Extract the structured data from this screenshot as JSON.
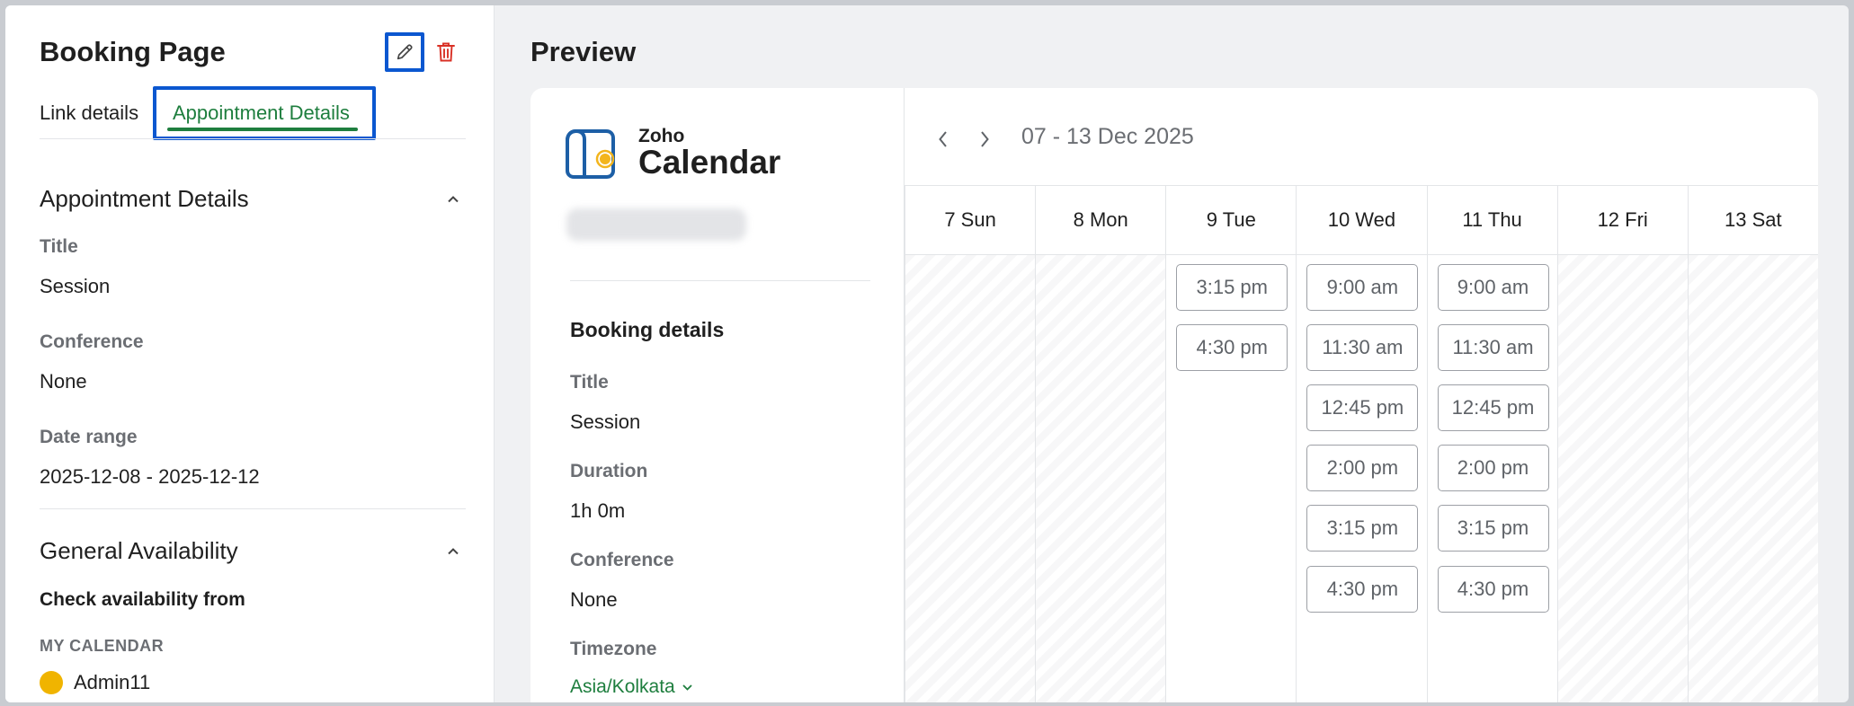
{
  "left_panel": {
    "title": "Booking Page",
    "edit_icon": "pencil-icon",
    "delete_icon": "trash-icon",
    "tabs": [
      {
        "label": "Link details",
        "active": false
      },
      {
        "label": "Appointment Details",
        "active": true
      }
    ],
    "appointment_section": {
      "heading": "Appointment Details",
      "fields": [
        {
          "label": "Title",
          "value": "Session"
        },
        {
          "label": "Conference",
          "value": "None"
        },
        {
          "label": "Date range",
          "value": "2025-12-08 - 2025-12-12"
        }
      ]
    },
    "availability_section": {
      "heading": "General Availability",
      "check_label": "Check availability from",
      "group_label": "MY CALENDAR",
      "calendars": [
        {
          "name": "Admin11",
          "color": "#f0b400"
        }
      ]
    }
  },
  "preview": {
    "title": "Preview",
    "logo": {
      "small": "Zoho",
      "large": "Calendar"
    },
    "booking": {
      "heading": "Booking details",
      "fields": [
        {
          "label": "Title",
          "value": "Session"
        },
        {
          "label": "Duration",
          "value": "1h 0m"
        },
        {
          "label": "Conference",
          "value": "None"
        }
      ],
      "timezone_label": "Timezone",
      "timezone_value": "Asia/Kolkata"
    },
    "calendar": {
      "range": "07 - 13 Dec 2025",
      "days": [
        {
          "label": "7 Sun",
          "slots": []
        },
        {
          "label": "8 Mon",
          "slots": []
        },
        {
          "label": "9 Tue",
          "slots": [
            "3:15 pm",
            "4:30 pm"
          ]
        },
        {
          "label": "10 Wed",
          "slots": [
            "9:00 am",
            "11:30 am",
            "12:45 pm",
            "2:00 pm",
            "3:15 pm",
            "4:30 pm"
          ]
        },
        {
          "label": "11 Thu",
          "slots": [
            "9:00 am",
            "11:30 am",
            "12:45 pm",
            "2:00 pm",
            "3:15 pm",
            "4:30 pm"
          ]
        },
        {
          "label": "12 Fri",
          "slots": []
        },
        {
          "label": "13 Sat",
          "slots": []
        }
      ]
    }
  },
  "colors": {
    "accent_green": "#1e7e3e",
    "highlight_blue": "#0b57d0",
    "delete_red": "#d93025"
  }
}
